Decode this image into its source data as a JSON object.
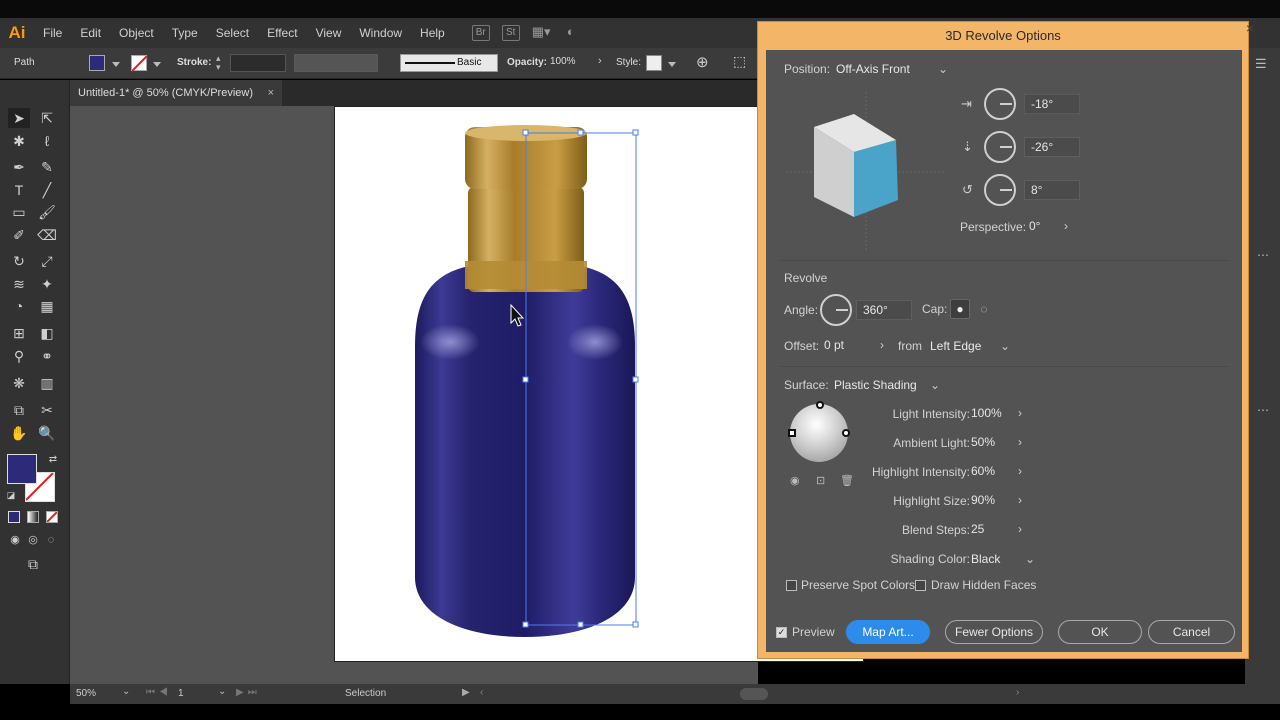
{
  "app": {
    "logo": "Ai"
  },
  "menu": [
    "File",
    "Edit",
    "Object",
    "Type",
    "Select",
    "Effect",
    "View",
    "Window",
    "Help"
  ],
  "menubar_icons": [
    "bridge-icon",
    "stock-icon",
    "arrange-documents-icon",
    "gpu-performance-icon"
  ],
  "controlbar": {
    "selection_type": "Path",
    "stroke_label": "Stroke:",
    "brush_style": "Basic",
    "opacity_label": "Opacity:",
    "opacity_value": "100%",
    "style_label": "Style:",
    "fill_color": "#2d2a7a"
  },
  "document_tab": {
    "title": "Untitled-1* @ 50% (CMYK/Preview)",
    "close": "×"
  },
  "statusbar": {
    "zoom": "50%",
    "artboard": "1",
    "tool": "Selection"
  },
  "dialog": {
    "title": "3D Revolve Options",
    "close": "×",
    "position_label": "Position:",
    "position_value": "Off-Axis Front",
    "rotation_x": "-18°",
    "rotation_y": "-26°",
    "rotation_z": "8°",
    "perspective_label": "Perspective:",
    "perspective_value": "0°",
    "revolve_header": "Revolve",
    "angle_label": "Angle:",
    "angle_value": "360°",
    "cap_label": "Cap:",
    "offset_label": "Offset:",
    "offset_value": "0 pt",
    "from_label": "from",
    "from_value": "Left Edge",
    "surface_label": "Surface:",
    "surface_value": "Plastic Shading",
    "light_intensity_label": "Light Intensity:",
    "light_intensity_value": "100%",
    "ambient_light_label": "Ambient Light:",
    "ambient_light_value": "50%",
    "highlight_intensity_label": "Highlight Intensity:",
    "highlight_intensity_value": "60%",
    "highlight_size_label": "Highlight Size:",
    "highlight_size_value": "90%",
    "blend_steps_label": "Blend Steps:",
    "blend_steps_value": "25",
    "shading_color_label": "Shading Color:",
    "shading_color_value": "Black",
    "preserve_spot_label": "Preserve Spot Colors",
    "draw_hidden_label": "Draw Hidden Faces",
    "preview_label": "Preview",
    "preview_checked": true,
    "map_art_button": "Map Art...",
    "fewer_options_button": "Fewer Options",
    "ok_button": "OK",
    "cancel_button": "Cancel",
    "cube_front_color": "#4aa3c8"
  },
  "bottle": {
    "body_color": "#2b2877",
    "cap_color": "#b8902e"
  }
}
